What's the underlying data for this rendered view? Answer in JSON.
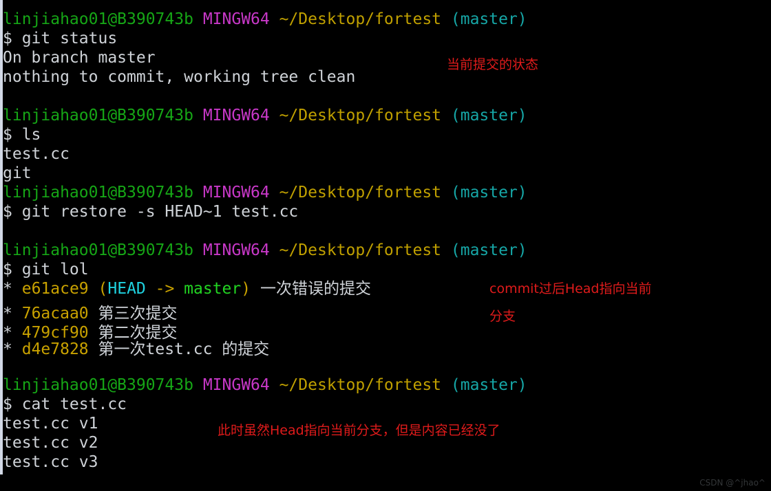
{
  "terminal": {
    "background": "#000000",
    "prompt": {
      "user_host": "linjiahao01@B390743b",
      "shell": "MINGW64",
      "path": "~/Desktop/fortest",
      "branch": "(master)",
      "symbol": "$"
    },
    "colors": {
      "user_host": "#16a616",
      "shell": "#c838c8",
      "path": "#c0a000",
      "branch": "#16a6a6",
      "default_text": "#cfd3d8",
      "commit_hash": "#c9a200",
      "head_ref": "#1fd2e0",
      "branch_ref": "#22d422",
      "annotation": "#e01b1b",
      "watermark": "#333638"
    },
    "blocks": [
      {
        "command": "$ git status",
        "output": [
          "On branch master",
          "nothing to commit, working tree clean"
        ]
      },
      {
        "command": "$ ls",
        "output": [
          "test.cc",
          "git"
        ]
      },
      {
        "command": "$ git restore -s HEAD~1 test.cc",
        "output": []
      },
      {
        "command": "$ git lol",
        "output": []
      },
      {
        "command": "$ cat test.cc",
        "output": [
          "test.cc v1",
          "test.cc v2",
          "test.cc v3"
        ]
      }
    ],
    "git_log": [
      {
        "marker": "*",
        "hash": "e61ace9",
        "refs_open": "(",
        "head": "HEAD",
        "arrow": " -> ",
        "branch": "master",
        "refs_close": ")",
        "message": "一次错误的提交"
      },
      {
        "marker": "*",
        "hash": "76acaa0",
        "message": "第三次提交"
      },
      {
        "marker": "*",
        "hash": "479cf90",
        "message": "第二次提交"
      },
      {
        "marker": "*",
        "hash": "d4e7828",
        "message": "第一次test.cc 的提交"
      }
    ],
    "annotations": [
      {
        "text": "当前提交的状态"
      },
      {
        "text": "commit过后Head指向当前"
      },
      {
        "text": "分支"
      },
      {
        "text": "此时虽然Head指向当前分支，但是内容已经没了"
      }
    ],
    "watermark": "CSDN @^jhao^"
  }
}
